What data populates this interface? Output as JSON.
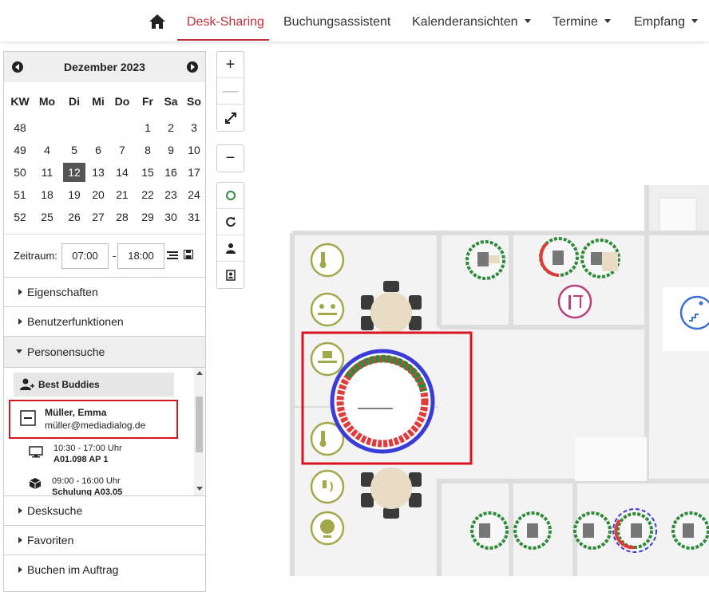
{
  "nav": {
    "home_icon": "home-icon",
    "items": [
      {
        "label": "Desk-Sharing",
        "active": true,
        "dropdown": false
      },
      {
        "label": "Buchungsassistent",
        "active": false,
        "dropdown": false
      },
      {
        "label": "Kalenderansichten",
        "active": false,
        "dropdown": true
      },
      {
        "label": "Termine",
        "active": false,
        "dropdown": true
      },
      {
        "label": "Empfang",
        "active": false,
        "dropdown": true
      }
    ],
    "accent_color": "#c0303b"
  },
  "calendar": {
    "title": "Dezember 2023",
    "headers": [
      "KW",
      "Mo",
      "Di",
      "Mi",
      "Do",
      "Fr",
      "Sa",
      "So"
    ],
    "rows": [
      [
        "48",
        "",
        "",
        "",
        "",
        "1",
        "2",
        "3"
      ],
      [
        "49",
        "4",
        "5",
        "6",
        "7",
        "8",
        "9",
        "10"
      ],
      [
        "50",
        "11",
        "12",
        "13",
        "14",
        "15",
        "16",
        "17"
      ],
      [
        "51",
        "18",
        "19",
        "20",
        "21",
        "22",
        "23",
        "24"
      ],
      [
        "52",
        "25",
        "26",
        "27",
        "28",
        "29",
        "30",
        "31"
      ]
    ],
    "selected_day": "12"
  },
  "zeitraum": {
    "label": "Zeitraum:",
    "from": "07:00",
    "separator": "-",
    "to": "18:00"
  },
  "accordion": [
    {
      "label": "Eigenschaften",
      "open": false
    },
    {
      "label": "Benutzerfunktionen",
      "open": false
    },
    {
      "label": "Personensuche",
      "open": true
    },
    {
      "label": "Desksuche",
      "open": false
    },
    {
      "label": "Favoriten",
      "open": false
    },
    {
      "label": "Buchen im Auftrag",
      "open": false
    }
  ],
  "personensuche": {
    "group_label": "Best Buddies",
    "person": {
      "name": "Müller, Emma",
      "email": "müller@mediadialog.de"
    },
    "bookings": [
      {
        "icon": "monitor-icon",
        "time": "10:30 - 17:00 Uhr",
        "place": "A01.098 AP 1"
      },
      {
        "icon": "cube-icon",
        "time": "09:00 - 16:00 Uhr",
        "place": "Schulung A03.05"
      }
    ]
  },
  "map_toolbar": {
    "zoom_in": "+",
    "zoom_reset": "—",
    "zoom_out": "−"
  },
  "colors": {
    "free": "#2e8b3a",
    "busy": "#e03a3a",
    "highlight": "#3b3bd9",
    "marker_box": "#d9141f"
  }
}
